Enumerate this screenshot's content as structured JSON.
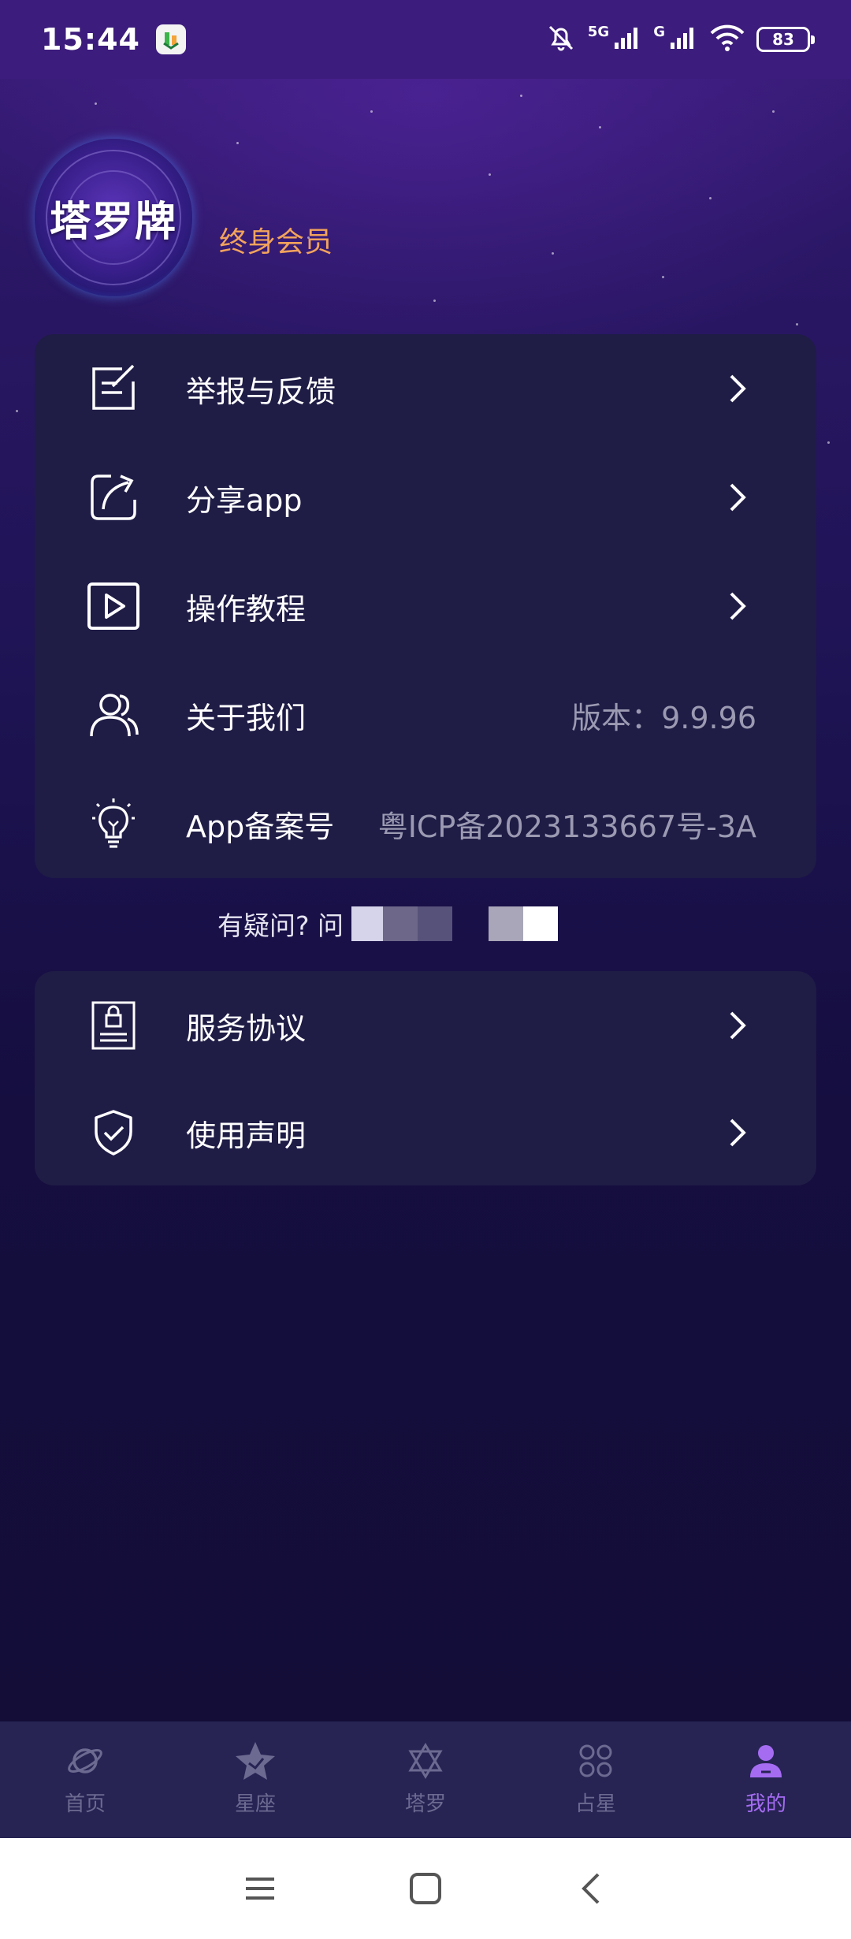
{
  "status_bar": {
    "time": "15:44",
    "network_1": "5G",
    "network_2": "G",
    "battery": "83"
  },
  "profile": {
    "avatar_text": "塔罗牌",
    "membership": "终身会员"
  },
  "menu_main": [
    {
      "icon": "feedback-icon",
      "label": "举报与反馈",
      "value": "",
      "chevron": true
    },
    {
      "icon": "share-icon",
      "label": "分享app",
      "value": "",
      "chevron": true
    },
    {
      "icon": "play-video-icon",
      "label": "操作教程",
      "value": "",
      "chevron": true
    },
    {
      "icon": "users-icon",
      "label": "关于我们",
      "value": "版本：9.9.96",
      "chevron": false
    },
    {
      "icon": "lightbulb-icon",
      "label": "App备案号",
      "value": "粤ICP备2023133667号-3A",
      "chevron": false
    }
  ],
  "question_text": "有疑问? 问",
  "menu_secondary": [
    {
      "icon": "document-lock-icon",
      "label": "服务协议",
      "chevron": true
    },
    {
      "icon": "shield-check-icon",
      "label": "使用声明",
      "chevron": true
    }
  ],
  "bottom_nav": [
    {
      "icon": "planet-icon",
      "label": "首页",
      "active": false
    },
    {
      "icon": "star-icon",
      "label": "星座",
      "active": false
    },
    {
      "icon": "hexagram-icon",
      "label": "塔罗",
      "active": false
    },
    {
      "icon": "clover-icon",
      "label": "占星",
      "active": false
    },
    {
      "icon": "person-icon",
      "label": "我的",
      "active": true
    }
  ],
  "colors": {
    "accent_active": "#a56cf2",
    "membership": "#f2a35c",
    "card_bg": "#1f1c46",
    "value_text": "#9b9ab2"
  }
}
